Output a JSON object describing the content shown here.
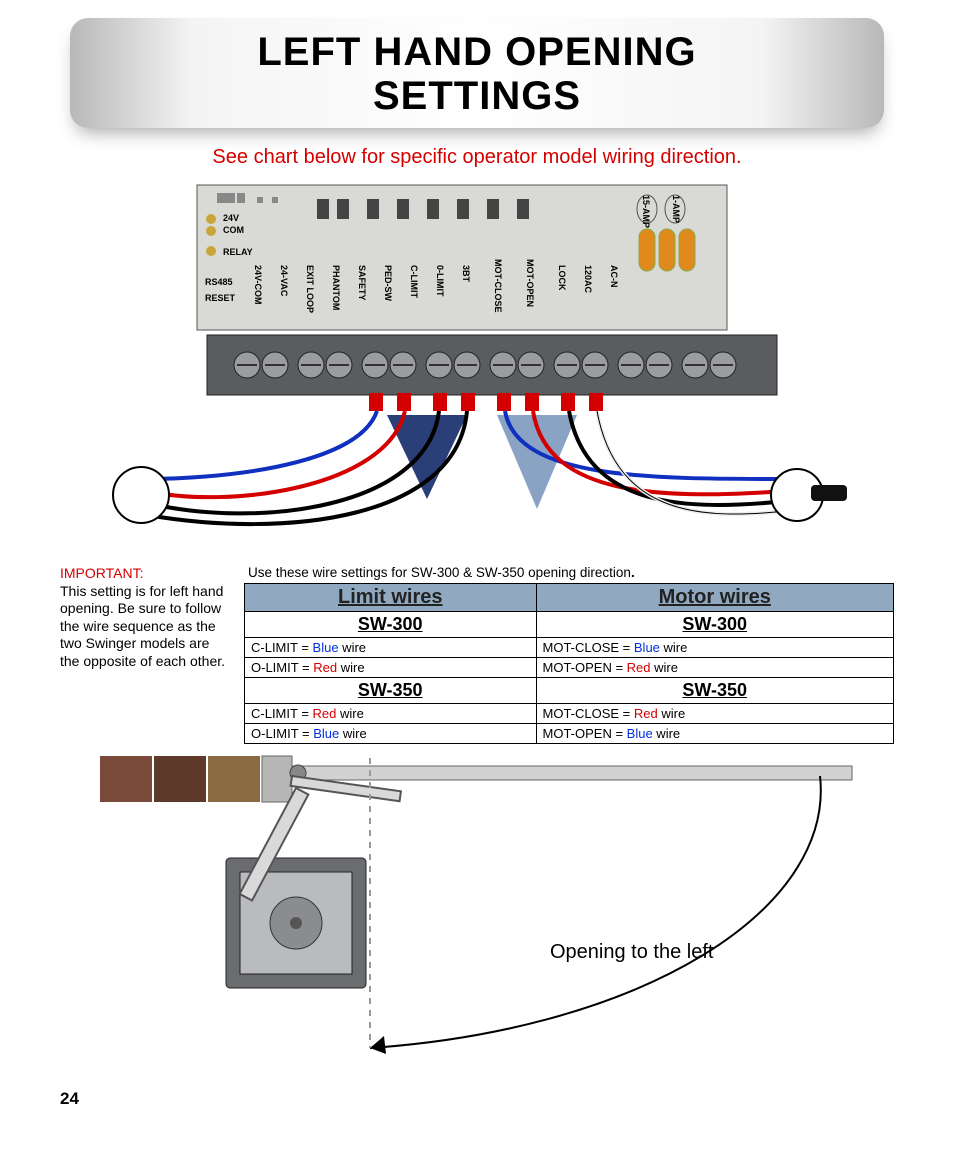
{
  "title_line1": "LEFT HAND OPENING",
  "title_line2": "SETTINGS",
  "subtitle": "See chart below for specific operator model wiring direction.",
  "board": {
    "side_labels": [
      "24V",
      "COM",
      "RELAY",
      "RS485",
      "RESET"
    ],
    "top_right_labels": [
      "15-AMP",
      "1-AMP"
    ],
    "terminals": [
      "24V-COM",
      "24-VAC",
      "EXIT LOOP",
      "PHANTOM",
      "SAFETY",
      "PED-SW",
      "C-LIMIT",
      "0-LIMIT",
      "3BT",
      "MOT-CLOSE",
      "MOT-OPEN",
      "LOCK",
      "120AC",
      "AC-N"
    ]
  },
  "important": {
    "label": "IMPORTANT:",
    "text": "This setting is for left hand opening. Be sure to follow the wire sequence as the two Swinger models are the opposite of each other."
  },
  "table": {
    "caption_prefix": "Use these wire settings for SW-300 & SW-350 opening direction",
    "caption_dot": ".",
    "headers": {
      "limit": "Limit wires",
      "motor": "Motor wires"
    },
    "models": {
      "sw300": "SW-300",
      "sw350": "SW-350"
    },
    "rows": {
      "sw300": {
        "limit_c": {
          "pre": "C-LIMIT = ",
          "color_word": "Blue",
          "post": " wire",
          "color": "blue"
        },
        "limit_o": {
          "pre": "O-LIMIT = ",
          "color_word": "Red",
          "post": " wire",
          "color": "red"
        },
        "motor_c": {
          "pre": "MOT-CLOSE = ",
          "color_word": "Blue",
          "post": " wire",
          "color": "blue"
        },
        "motor_o": {
          "pre": "MOT-OPEN = ",
          "color_word": "Red",
          "post": " wire",
          "color": "red"
        }
      },
      "sw350": {
        "limit_c": {
          "pre": "C-LIMIT = ",
          "color_word": "Red",
          "post": " wire",
          "color": "red"
        },
        "limit_o": {
          "pre": "O-LIMIT = ",
          "color_word": "Blue",
          "post": " wire",
          "color": "blue"
        },
        "motor_c": {
          "pre": "MOT-CLOSE = ",
          "color_word": "Red",
          "post": " wire",
          "color": "red"
        },
        "motor_o": {
          "pre": "MOT-OPEN = ",
          "color_word": "Blue",
          "post": " wire",
          "color": "blue"
        }
      }
    }
  },
  "opening_label": "Opening to the left",
  "page_number": "24"
}
